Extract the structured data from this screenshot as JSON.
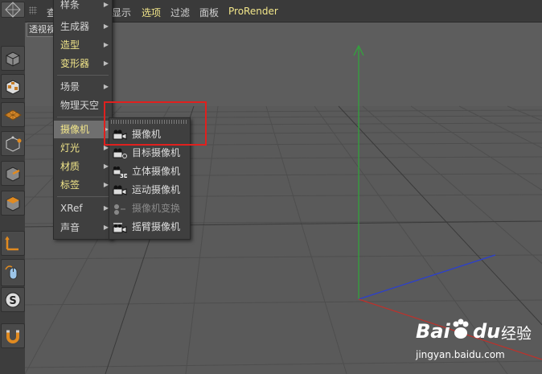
{
  "menubar": {
    "items": [
      {
        "label": "查",
        "key": "view-menu"
      },
      {
        "label": "显示",
        "key": "display-menu"
      },
      {
        "label": "选项",
        "key": "options-menu",
        "highlight": true
      },
      {
        "label": "过滤",
        "key": "filter-menu"
      },
      {
        "label": "面板",
        "key": "panel-menu"
      },
      {
        "label": "ProRender",
        "key": "prorender-menu",
        "highlight": true
      }
    ]
  },
  "viewport": {
    "view_label": "透视视图"
  },
  "create_menu": {
    "items": [
      {
        "label": "样条",
        "has_submenu": true
      },
      {
        "label": "生成器",
        "has_submenu": true
      },
      {
        "label": "造型",
        "has_submenu": true,
        "highlight": true
      },
      {
        "label": "变形器",
        "has_submenu": true,
        "highlight": true
      },
      {
        "label": "场景",
        "has_submenu": true
      },
      {
        "label": "物理天空",
        "has_submenu": false
      },
      {
        "label": "摄像机",
        "has_submenu": true,
        "selected": true
      },
      {
        "label": "灯光",
        "has_submenu": true,
        "highlight": true
      },
      {
        "label": "材质",
        "has_submenu": true,
        "highlight": true
      },
      {
        "label": "标签",
        "has_submenu": true,
        "highlight": true
      },
      {
        "label": "XRef",
        "has_submenu": true
      },
      {
        "label": "声音",
        "has_submenu": true
      }
    ]
  },
  "camera_submenu": {
    "items": [
      {
        "label": "摄像机",
        "icon": "camera-icon"
      },
      {
        "label": "目标摄像机",
        "icon": "target-camera-icon"
      },
      {
        "label": "立体摄像机",
        "icon": "stereo-camera-icon"
      },
      {
        "label": "运动摄像机",
        "icon": "motion-camera-icon"
      },
      {
        "label": "摄像机变换",
        "icon": "camera-morph-icon",
        "disabled": true
      },
      {
        "label": "摇臂摄像机",
        "icon": "crane-camera-icon"
      }
    ]
  },
  "watermark": {
    "brand": "Bai",
    "brand2": "du",
    "product": "经验",
    "url": "jingyan.baidu.com"
  },
  "colors": {
    "menu_highlight": "#f2e68a",
    "annotation_box": "#e0201e",
    "y_axis": "#2fa83a",
    "x_axis": "#c0302a",
    "z_axis": "#2a3fd0"
  }
}
